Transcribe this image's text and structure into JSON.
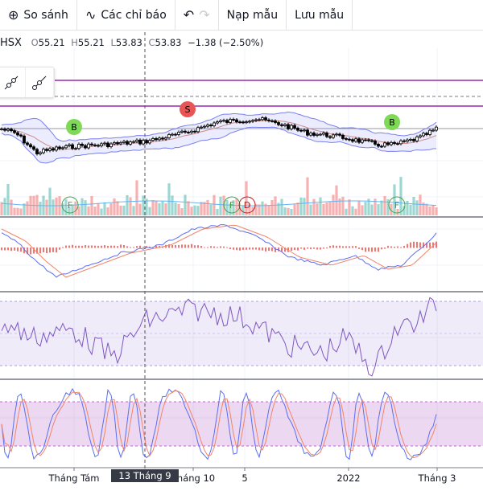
{
  "toolbar": {
    "compare": "So sánh",
    "indicators": "Các chỉ báo",
    "load_template": "Nạp mẫu",
    "save_template": "Lưu mẫu"
  },
  "legend": {
    "symbol": "HSX",
    "o_label": "O",
    "o": "55.21",
    "h_label": "H",
    "h": "55.21",
    "l_label": "L",
    "l": "53.83",
    "c_label": "C",
    "c": "53.83",
    "change": "−1.38 (−2.50%)"
  },
  "markers": {
    "buy": "B",
    "sell": "S",
    "f": "F",
    "d": "D"
  },
  "xaxis": {
    "labels": [
      "Tháng Tám",
      "Tháng 10",
      "5",
      "2022",
      "Tháng 3"
    ],
    "crosshair": "13 Tháng 9 '21"
  },
  "colors": {
    "up": "#26a69a",
    "down": "#ef5350",
    "band": "#7b7ff0",
    "macd": "#5b6ef0",
    "signal": "#f0856a",
    "rsi": "#7e57c2",
    "level": "#9c27b0"
  }
}
